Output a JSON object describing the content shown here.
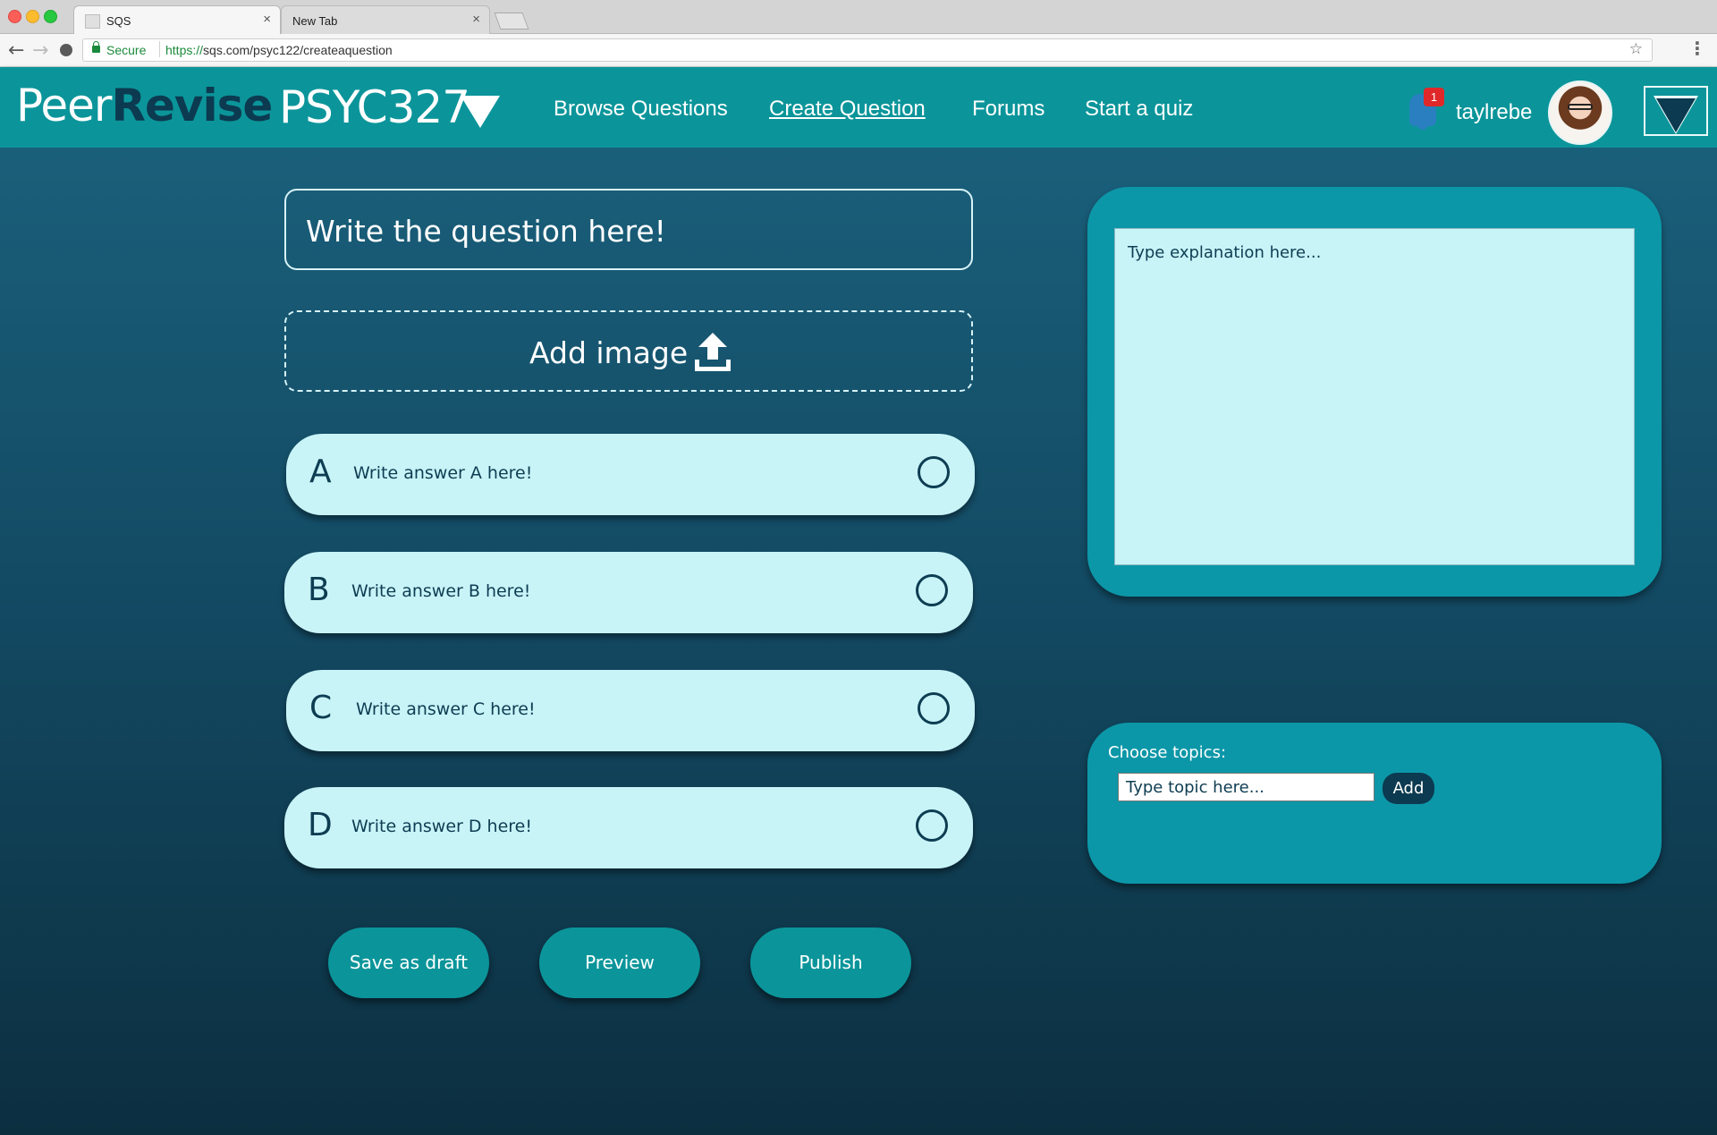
{
  "browser": {
    "tabs": [
      {
        "title": "SQS",
        "active": true
      },
      {
        "title": "New Tab",
        "active": false
      }
    ],
    "close_glyph": "×",
    "secure_label": "Secure",
    "url_scheme": "https://",
    "url_rest": "sqs.com/psyc122/createaquestion"
  },
  "header": {
    "logo_light": "Peer",
    "logo_bold": "Revise",
    "course": "PSYC327",
    "nav": {
      "browse": "Browse Questions",
      "create": "Create Question",
      "forums": "Forums",
      "quiz": "Start a quiz"
    },
    "notification_count": "1",
    "username": "taylrebe"
  },
  "question": {
    "placeholder": "Write the question here!",
    "image_label": "Add image"
  },
  "answers": [
    {
      "letter": "A",
      "text": "Write answer A here!"
    },
    {
      "letter": "B",
      "text": "Write answer B here!"
    },
    {
      "letter": "C",
      "text": "Write answer C here!"
    },
    {
      "letter": "D",
      "text": "Write answer D here!"
    }
  ],
  "actions": {
    "draft": "Save as draft",
    "preview": "Preview",
    "publish": "Publish"
  },
  "explanation": {
    "placeholder": "Type explanation here..."
  },
  "topics": {
    "label": "Choose topics:",
    "placeholder": "Type topic here...",
    "add": "Add"
  },
  "colors": {
    "header_teal": "#0b959a",
    "panel_teal": "#0c97a8",
    "answer_bg": "#c8f4f8",
    "dark_navy": "#0c3a50",
    "badge_red": "#e0282a"
  },
  "icons": {
    "upload": "upload-icon",
    "bell": "bell-icon",
    "menu": "menu-toggle"
  }
}
